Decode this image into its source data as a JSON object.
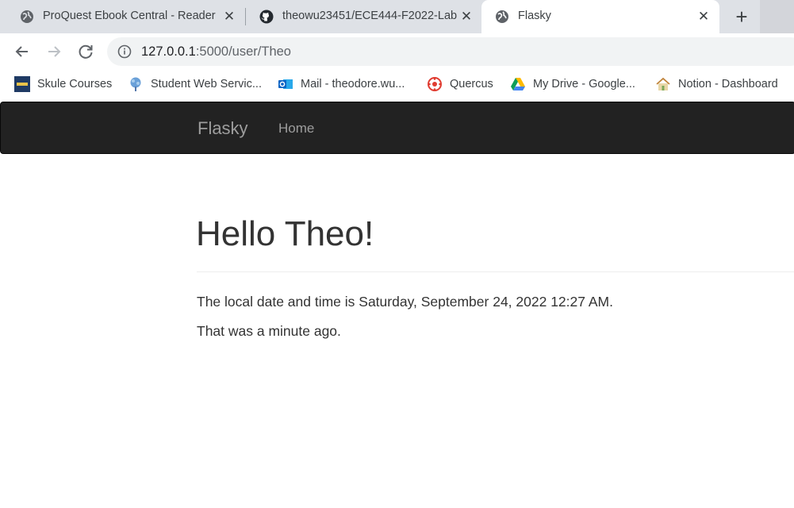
{
  "browser": {
    "tabs": [
      {
        "title": "ProQuest Ebook Central - Reader",
        "icon": "globe-icon",
        "active": false
      },
      {
        "title": "theowu23451/ECE444-F2022-Lab",
        "icon": "github-icon",
        "active": false
      },
      {
        "title": "Flasky",
        "icon": "globe-icon",
        "active": true
      }
    ],
    "new_tab_glyph": "+",
    "close_glyph": "✕",
    "address": {
      "host": "127.0.0.1",
      "rest": ":5000/user/Theo"
    },
    "bookmarks": [
      {
        "label": "Skule Courses",
        "icon": "skule-icon"
      },
      {
        "label": "Student Web Servic...",
        "icon": "tree-icon"
      },
      {
        "label": "Mail - theodore.wu...",
        "icon": "outlook-icon"
      },
      {
        "label": "Quercus",
        "icon": "quercus-icon"
      },
      {
        "label": "My Drive - Google...",
        "icon": "google-drive-icon"
      },
      {
        "label": "Notion - Dashboard",
        "icon": "house-icon"
      }
    ]
  },
  "app": {
    "brand": "Flasky",
    "nav": [
      {
        "label": "Home"
      }
    ],
    "heading": "Hello Theo!",
    "paragraphs": [
      "The local date and time is Saturday, September 24, 2022 12:27 AM.",
      "That was a minute ago."
    ]
  },
  "colors": {
    "navbar_bg": "#222222",
    "navbar_text": "#9d9d9d",
    "body_text": "#333333",
    "tabstrip_bg": "#dee1e6"
  }
}
